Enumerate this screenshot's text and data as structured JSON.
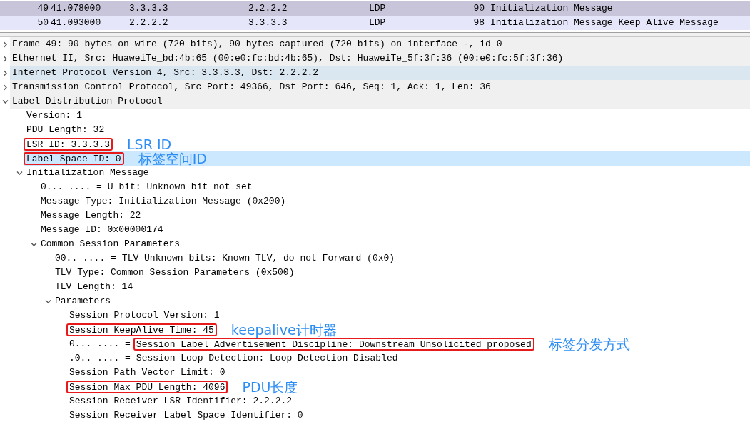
{
  "packet_list": {
    "rows": [
      {
        "no": "49",
        "time": "41.078000",
        "source": "3.3.3.3",
        "destination": "2.2.2.2",
        "protocol": "LDP",
        "length": "90",
        "info": "Initialization Message",
        "selected": true
      },
      {
        "no": "50",
        "time": "41.093000",
        "source": "2.2.2.2",
        "destination": "3.3.3.3",
        "protocol": "LDP",
        "length": "98",
        "info": "Initialization Message Keep Alive Message",
        "selected": false
      }
    ]
  },
  "details": {
    "items": [
      {
        "text": "Frame 49: 90 bytes on wire (720 bits), 90 bytes captured (720 bits) on interface -, id 0",
        "expanded": false,
        "selected": false,
        "hovered": false
      },
      {
        "text": "Ethernet II, Src: HuaweiTe_bd:4b:65 (00:e0:fc:bd:4b:65), Dst: HuaweiTe_5f:3f:36 (00:e0:fc:5f:3f:36)",
        "expanded": false,
        "selected": false,
        "hovered": false
      },
      {
        "text": "Internet Protocol Version 4, Src: 3.3.3.3, Dst: 2.2.2.2",
        "expanded": false,
        "selected": false,
        "hovered": true
      },
      {
        "text": "Transmission Control Protocol, Src Port: 49366, Dst Port: 646, Seq: 1, Ack: 1, Len: 36",
        "expanded": false,
        "selected": false,
        "hovered": false
      },
      {
        "text": "Label Distribution Protocol",
        "expanded": true,
        "selected": false,
        "hovered": false,
        "children": [
          {
            "text": "Version: 1",
            "selected": false,
            "hovered": false,
            "boxed": false
          },
          {
            "text": "PDU Length: 32",
            "selected": false,
            "hovered": false,
            "boxed": false
          },
          {
            "text": "LSR ID: 3.3.3.3",
            "selected": false,
            "hovered": false,
            "boxed": true,
            "note": "LSR ID"
          },
          {
            "text": "Label Space ID: 0",
            "selected": true,
            "hovered": false,
            "boxed": true,
            "note": "标签空间ID"
          },
          {
            "text": "Initialization Message",
            "expanded": true,
            "selected": false,
            "hovered": false,
            "children": [
              {
                "bits": "0... .... =",
                "text": "U bit: Unknown bit not set",
                "selected": false,
                "hovered": false,
                "boxed": false
              },
              {
                "text": "Message Type: Initialization Message (0x200)",
                "selected": false,
                "hovered": false,
                "boxed": false
              },
              {
                "text": "Message Length: 22",
                "selected": false,
                "hovered": false,
                "boxed": false
              },
              {
                "text": "Message ID: 0x00000174",
                "selected": false,
                "hovered": false,
                "boxed": false
              },
              {
                "text": "Common Session Parameters",
                "expanded": true,
                "selected": false,
                "hovered": false,
                "children": [
                  {
                    "bits": "00.. .... =",
                    "text": "TLV Unknown bits: Known TLV, do not Forward (0x0)",
                    "selected": false,
                    "hovered": false,
                    "boxed": false
                  },
                  {
                    "text": "TLV Type: Common Session Parameters (0x500)",
                    "selected": false,
                    "hovered": false,
                    "boxed": false
                  },
                  {
                    "text": "TLV Length: 14",
                    "selected": false,
                    "hovered": false,
                    "boxed": false
                  },
                  {
                    "text": "Parameters",
                    "expanded": true,
                    "selected": false,
                    "hovered": false,
                    "children": [
                      {
                        "text": "Session Protocol Version: 1",
                        "selected": false,
                        "hovered": false,
                        "boxed": false
                      },
                      {
                        "text": "Session KeepAlive Time: 45",
                        "selected": false,
                        "hovered": false,
                        "boxed": true,
                        "note": "keepalive计时器"
                      },
                      {
                        "bits": "0... .... =",
                        "text": "Session Label Advertisement Discipline: Downstream Unsolicited proposed",
                        "selected": false,
                        "hovered": false,
                        "boxed": true,
                        "note": "标签分发方式"
                      },
                      {
                        "bits": ".0.. .... =",
                        "text": "Session Loop Detection: Loop Detection Disabled",
                        "selected": false,
                        "hovered": false,
                        "boxed": false
                      },
                      {
                        "text": "Session Path Vector Limit: 0",
                        "selected": false,
                        "hovered": false,
                        "boxed": false
                      },
                      {
                        "text": "Session Max PDU Length: 4096",
                        "selected": false,
                        "hovered": false,
                        "boxed": true,
                        "note": "PDU长度"
                      },
                      {
                        "text": "Session Receiver LSR Identifier: 2.2.2.2",
                        "selected": false,
                        "hovered": false,
                        "boxed": false
                      },
                      {
                        "text": "Session Receiver Label Space Identifier: 0",
                        "selected": false,
                        "hovered": false,
                        "boxed": false
                      }
                    ]
                  }
                ]
              }
            ]
          }
        ]
      }
    ]
  }
}
